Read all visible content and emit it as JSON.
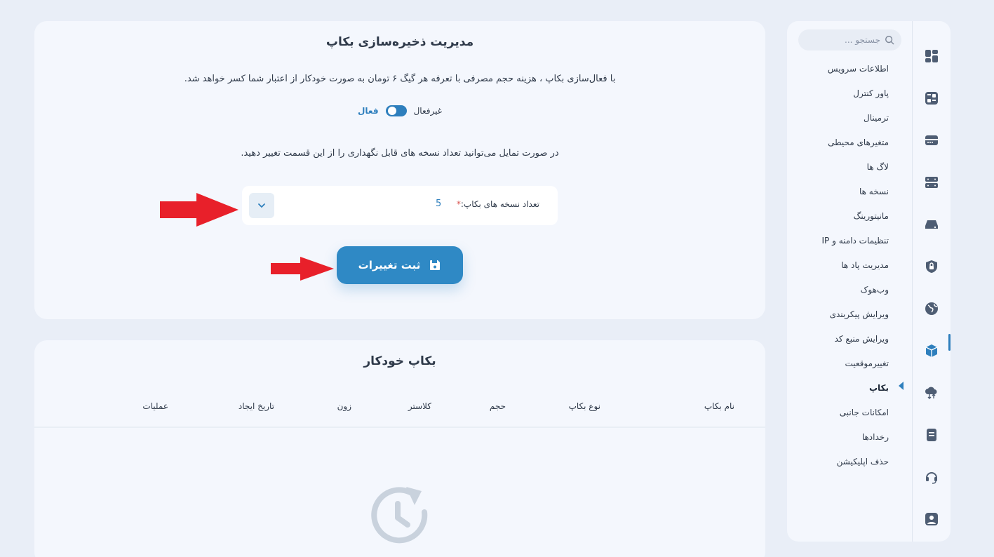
{
  "sidebar": {
    "search_placeholder": "جستجو ...",
    "items": [
      {
        "label": "اطلاعات سرویس"
      },
      {
        "label": "پاور کنترل"
      },
      {
        "label": "ترمینال"
      },
      {
        "label": "متغیرهای محیطی"
      },
      {
        "label": "لاگ ها"
      },
      {
        "label": "نسخه ها"
      },
      {
        "label": "مانیتورینگ"
      },
      {
        "label": "تنظیمات دامنه و IP"
      },
      {
        "label": "مدیریت پاد ها"
      },
      {
        "label": "وب‌هوک"
      },
      {
        "label": "ویرایش پیکربندی"
      },
      {
        "label": "ویرایش منبع کد"
      },
      {
        "label": "تغییرموقعیت"
      },
      {
        "label": "بکاپ",
        "active": true
      },
      {
        "label": "امکانات جانبی"
      },
      {
        "label": "رخدادها"
      },
      {
        "label": "حذف اپلیکیشن"
      }
    ],
    "rail_icons": [
      "dashboard-icon",
      "calculator-icon",
      "server-icon",
      "servers-icon",
      "storage-icon",
      "shield-lock-icon",
      "globe-icon",
      "package-icon",
      "cloud-transfer-icon",
      "document-icon",
      "headset-icon",
      "user-icon"
    ],
    "active_rail_icon": "package-icon"
  },
  "backup_settings": {
    "title": "مدیریت ذخیره‌سازی بکاپ",
    "description": "با فعال‌سازی بکاپ ، هزینه حجم مصرفی با تعرفه هر گیگ ۶ تومان به صورت خودکار از اعتبار شما کسر خواهد شد.",
    "toggle_off_label": "غیرفعال",
    "toggle_on_label": "فعال",
    "toggle_state": "on",
    "versions_hint": "در صورت تمایل می‌توانید تعداد نسخه های قابل نگهداری را از این قسمت تغییر دهید.",
    "versions_label": "تعداد نسخه های بکاپ:",
    "required_mark": "*",
    "versions_value": "5",
    "save_label": "ثبت تغییرات"
  },
  "auto_backup": {
    "title": "بکاپ خودکار",
    "columns": [
      "نام بکاپ",
      "نوع بکاپ",
      "حجم",
      "کلاستر",
      "زون",
      "تاریخ ایجاد",
      "عملیات"
    ],
    "rows": []
  },
  "colors": {
    "accent": "#2f89c5",
    "background": "#e9eef7",
    "card": "#f4f7fd",
    "annotation_arrow": "#e8202a"
  }
}
